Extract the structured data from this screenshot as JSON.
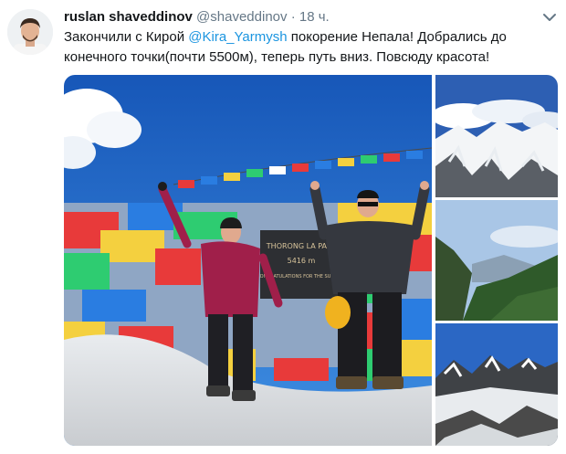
{
  "tweet": {
    "author_name": "ruslan shaveddinov",
    "author_handle": "@shaveddinov",
    "separator": "·",
    "timestamp": "18 ч.",
    "text_part1": "Закончили с Кирой ",
    "mention": "@Kira_Yarmysh",
    "text_part2": " покорение Непала! Добрались до конечного точки(почти 5500м), теперь путь вниз. Повсюду красота!"
  },
  "sign": {
    "line1": "THORONG LA PASS",
    "line2": "5416 m",
    "line3": "CONGRATULATIONS FOR THE SUCCESS"
  },
  "colors": {
    "name": "#14171a",
    "secondary_text": "#657786",
    "link": "#1b95e0",
    "sky": "#1f6fcf"
  }
}
